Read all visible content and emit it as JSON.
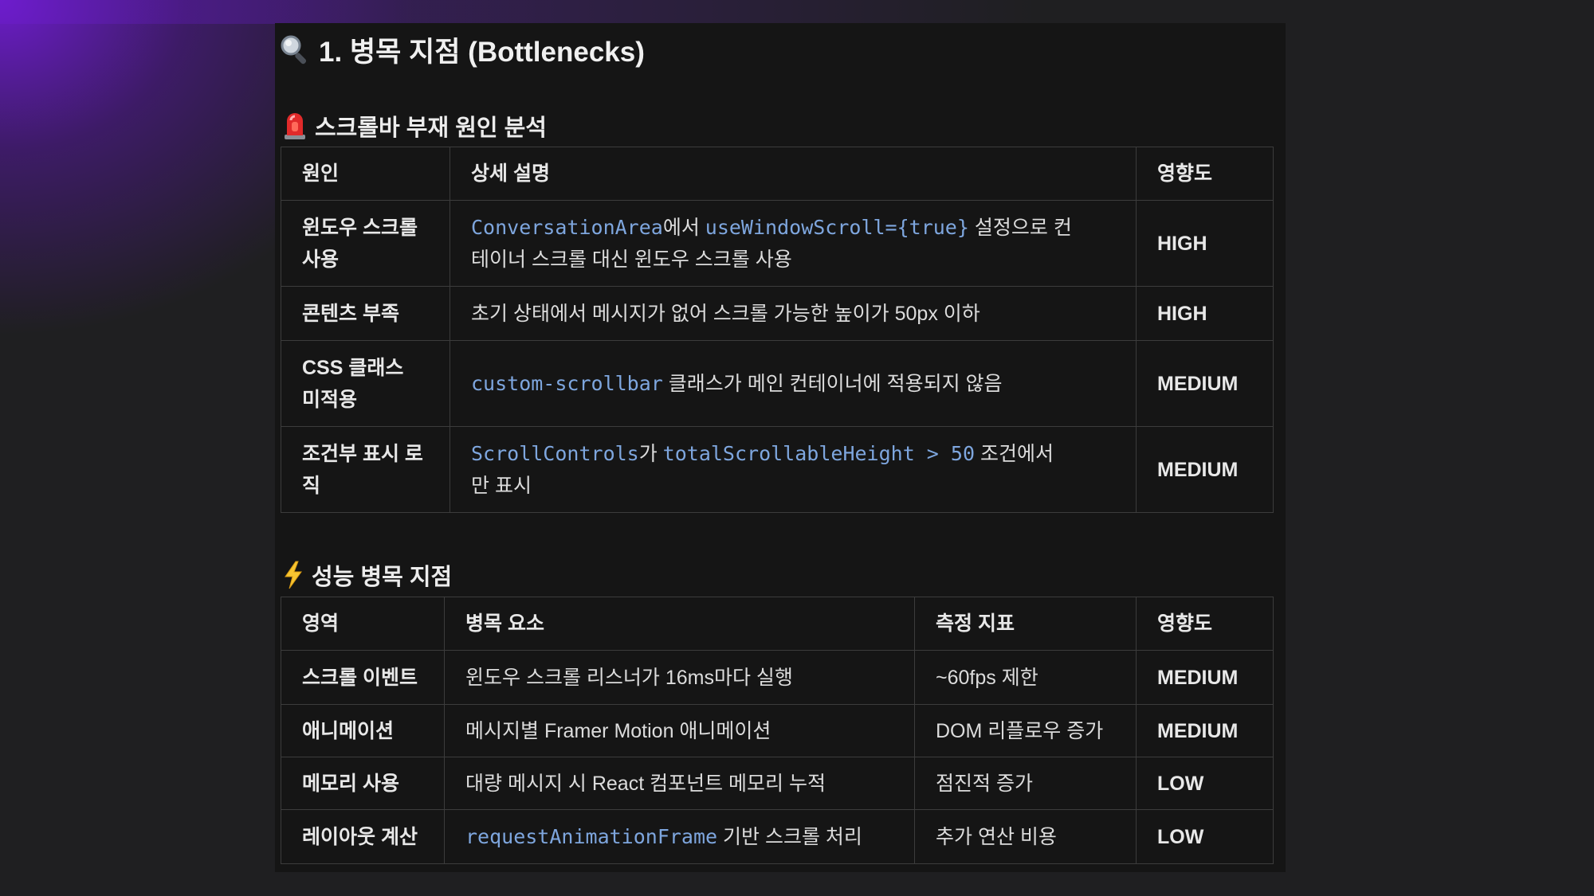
{
  "heading": {
    "title": "1. 병목 지점 (Bottlenecks)",
    "icon": "magnifier-icon"
  },
  "section1": {
    "title": "스크롤바 부재 원인 분석",
    "icon": "siren-icon",
    "headers": [
      "원인",
      "상세 설명",
      "영향도"
    ],
    "rows": [
      {
        "cause_l1": "윈도우 스크롤",
        "cause_l2": "사용",
        "code1": "ConversationArea",
        "text1": "에서 ",
        "code2": "useWindowScroll={true}",
        "text2": " 설정으로 컨",
        "text3": "테이너 스크롤 대신 윈도우 스크롤 사용",
        "impact": "HIGH"
      },
      {
        "cause_l1": "콘텐츠 부족",
        "text1": "초기 상태에서 메시지가 없어 스크롤 가능한 높이가 50px 이하",
        "impact": "HIGH"
      },
      {
        "cause_l1": "CSS 클래스",
        "cause_l2": "미적용",
        "code1": "custom-scrollbar",
        "text1": " 클래스가 메인 컨테이너에 적용되지 않음",
        "impact": "MEDIUM"
      },
      {
        "cause_l1": "조건부 표시 로",
        "cause_l2": "직",
        "code1": "ScrollControls",
        "text1": "가 ",
        "code2": "totalScrollableHeight > 50",
        "text2": " 조건에서",
        "text3": "만 표시",
        "impact": "MEDIUM"
      }
    ]
  },
  "section2": {
    "title": "성능 병목 지점",
    "icon": "lightning-icon",
    "headers": [
      "영역",
      "병목 요소",
      "측정 지표",
      "영향도"
    ],
    "rows": [
      {
        "area": "스크롤 이벤트",
        "element": "윈도우 스크롤 리스너가 16ms마다 실행",
        "metric": "~60fps 제한",
        "impact": "MEDIUM"
      },
      {
        "area": "애니메이션",
        "element": "메시지별 Framer Motion 애니메이션",
        "metric": "DOM 리플로우 증가",
        "impact": "MEDIUM"
      },
      {
        "area": "메모리 사용",
        "element": "대량 메시지 시 React 컴포넌트 메모리 누적",
        "metric": "점진적 증가",
        "impact": "LOW"
      },
      {
        "area": "레이아웃 계산",
        "code": "requestAnimationFrame",
        "element": " 기반 스크롤 처리",
        "metric": "추가 연산 비용",
        "impact": "LOW"
      }
    ]
  }
}
